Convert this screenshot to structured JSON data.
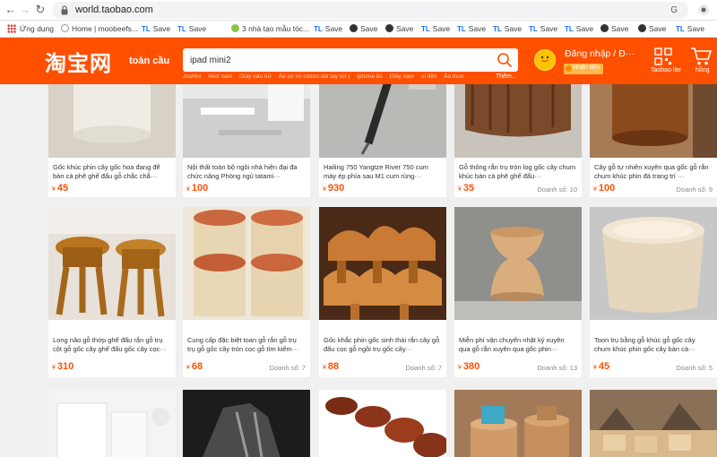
{
  "browser": {
    "url": "world.taobao.com"
  },
  "bookmarks": {
    "apps": "Ứng dụng",
    "items": [
      "Home | moobeefs...",
      "Save",
      "Save",
      "3 nhà tạo mẫu tóc...",
      "Save",
      "Save",
      "Save",
      "Save",
      "Save",
      "Save",
      "Save",
      "Save",
      "Save",
      "Save",
      "Save"
    ]
  },
  "header": {
    "logo": "淘宝网",
    "logo_sub": "toàn cầu",
    "search_value": "ipad mini2",
    "hot_words": [
      "Joshini",
      "Vest nam",
      "Giày nâu nữ",
      "Áo sơ mi cotton dài tay nữ |",
      "Iphone 8s",
      "Giày nam",
      "ví tiền",
      "Áo thun"
    ],
    "more": "Thêm...",
    "login": "Đăng nhập  /  Đ···",
    "receive": "Nhận tiền",
    "lite": "Taobao lite",
    "cart": "hồng"
  },
  "products": {
    "row1": [
      {
        "title": "Gốc khúc phin cây gốc hoa đang để bàn cà phê ghế đẩu gỗ chắc chắ···",
        "price": "45",
        "sales": ""
      },
      {
        "title": "Nội thất toàn bộ ngôi nhà hiện đại đa chức năng Phòng ngủ tatami···",
        "price": "100",
        "sales": ""
      },
      {
        "title": "Hailing 750 Yangtze River 750 cum máy ép phía sau M1 cum rùng···",
        "price": "930",
        "sales": ""
      },
      {
        "title": "Gỗ thông rắn trụ tròn log gốc cây chum khúc bàn cà phê ghế đẩu···",
        "price": "35",
        "sales": "Doanh số: 10"
      },
      {
        "title": "Cây gỗ tự nhiên xuyên qua gốc gỗ rắn chum khúc phin đá trang trí ···",
        "price": "100",
        "sales": "Doanh số: 9"
      }
    ],
    "row2": [
      {
        "title": "Long não gỗ thớp ghế đẩu rắn gỗ trụ cột gỗ gốc cây ghế đẩu gốc cây cọc···",
        "price": "310",
        "sales": ""
      },
      {
        "title": "Cung cấp đặc biệt toan gỗ rắn gỗ trụ trụ gỗ gốc cây tròn cọc gỗ tìm kiếm···",
        "price": "68",
        "sales": "Doanh số: 7"
      },
      {
        "title": "Gốc khắc phin gốc sinh thái rắn cây gỗ đẩu cọc gỗ ngồi trụ gốc cây···",
        "price": "88",
        "sales": "Doanh số: 7"
      },
      {
        "title": "Miễn phí vận chuyển nhật ký xuyên qua gỗ rắn xuyên qua gốc phin···",
        "price": "380",
        "sales": "Doanh số: 13"
      },
      {
        "title": "Toon trụ bằng gỗ khúc gỗ gốc cây chum khúc phin gốc cây bàn cà···",
        "price": "45",
        "sales": "Doanh số: 5"
      }
    ]
  },
  "colors": {
    "brand": "#ff5000",
    "price": "#ff5000"
  }
}
